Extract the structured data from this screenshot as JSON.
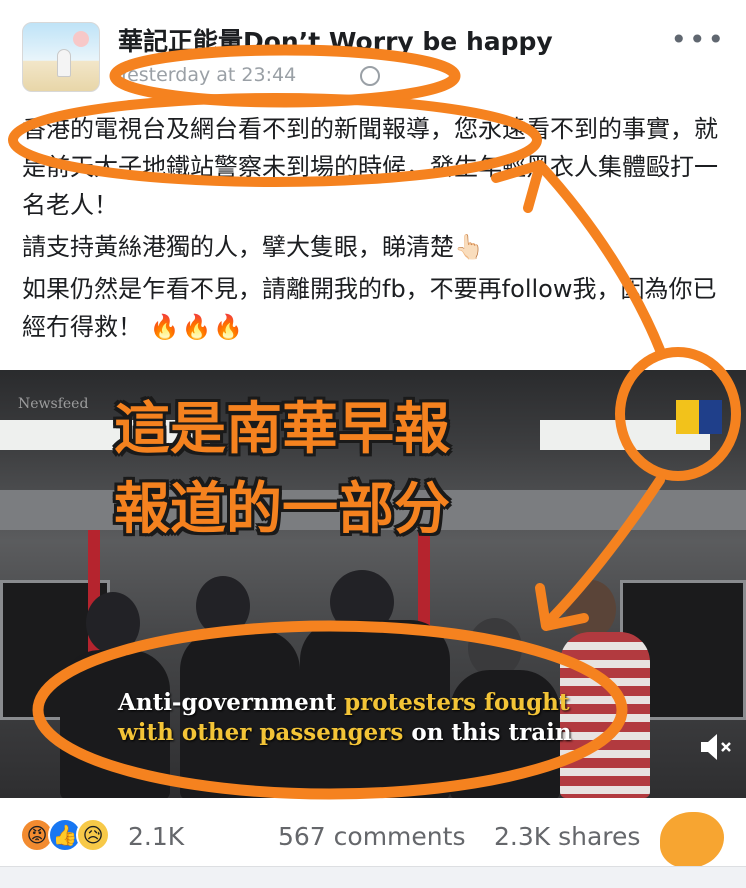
{
  "post": {
    "author": "華記正能量Don’t Worry be happy",
    "timestamp": "Yesterday at 23:44",
    "privacy_icon": "globe-icon",
    "more_icon": "more-options-icon",
    "paragraphs": [
      "香港的電視台及網台看不到的新聞報導，您永遠看不到的事實，就是前天太子地鐵站警察未到場的時候，發生年輕黑衣人集體毆打一名老人！",
      "請支持黃絲港獨的人，擘大隻眼，睇清楚👆🏻",
      "如果仍然是乍看不見，請離開我的fb，不要再follow我，因為你已經冇得救！"
    ],
    "flames": "🔥🔥🔥"
  },
  "video": {
    "overlay_caption_line1": "這是南華早報",
    "overlay_caption_line2": "報道的一部分",
    "subtitle_part1": "Anti-government ",
    "subtitle_part2": "protesters fought",
    "subtitle_part3": "with other passengers",
    "subtitle_part4": " on this train",
    "watermark": "Newsfeed",
    "mute_icon": "speaker-muted-icon"
  },
  "footer": {
    "reactions": [
      "angry",
      "like",
      "sad"
    ],
    "reaction_count": "2.1K",
    "comments": "567 comments",
    "shares": "2.3K shares"
  },
  "colors": {
    "annotation_orange": "#f5821f",
    "subtitle_yellow": "#f3c437",
    "like_blue": "#1877f2"
  }
}
